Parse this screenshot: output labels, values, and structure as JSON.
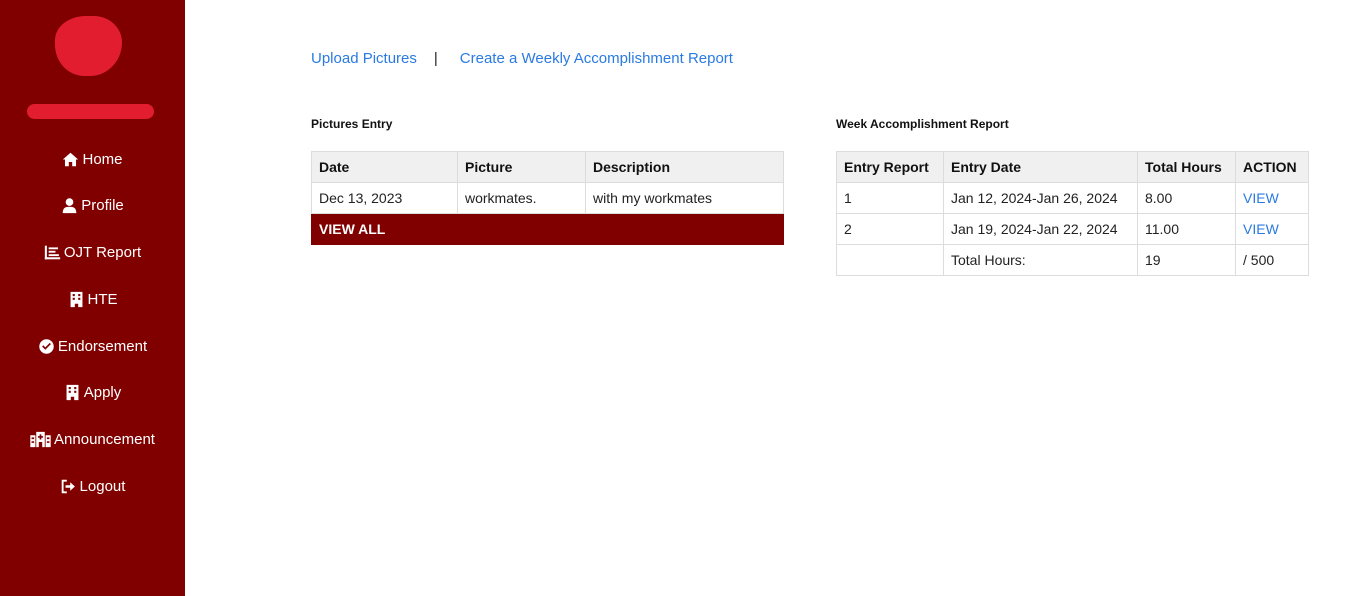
{
  "sidebar": {
    "items": [
      {
        "label": "Home",
        "icon": "home-icon"
      },
      {
        "label": "Profile",
        "icon": "user-icon"
      },
      {
        "label": "OJT Report",
        "icon": "report-icon"
      },
      {
        "label": "HTE",
        "icon": "building-icon"
      },
      {
        "label": "Endorsement",
        "icon": "check-circle-icon"
      },
      {
        "label": "Apply",
        "icon": "building-icon"
      },
      {
        "label": "Announcement",
        "icon": "hospital-icon"
      },
      {
        "label": "Logout",
        "icon": "logout-icon"
      }
    ]
  },
  "toplinks": {
    "upload": "Upload Pictures",
    "separator": "|",
    "create": "Create a Weekly Accomplishment Report"
  },
  "pictures": {
    "title": "Pictures Entry",
    "headers": [
      "Date",
      "Picture",
      "Description"
    ],
    "rows": [
      [
        "Dec 13, 2023",
        "workmates.",
        "with my workmates"
      ]
    ],
    "view_all": "VIEW ALL"
  },
  "weekly": {
    "title": "Week Accomplishment Report",
    "headers": [
      "Entry Report",
      "Entry Date",
      "Total Hours",
      "ACTION"
    ],
    "rows": [
      [
        "1",
        "Jan 12, 2024-Jan 26, 2024",
        "8.00",
        "VIEW"
      ],
      [
        "2",
        "Jan 19, 2024-Jan 22, 2024",
        "11.00",
        "VIEW"
      ]
    ],
    "total_label": "Total Hours:",
    "total_value": "19",
    "total_required": "/ 500"
  },
  "colors": {
    "sidebar": "#800000",
    "link": "#2a7ae2",
    "redaction": "#e21d2f"
  }
}
